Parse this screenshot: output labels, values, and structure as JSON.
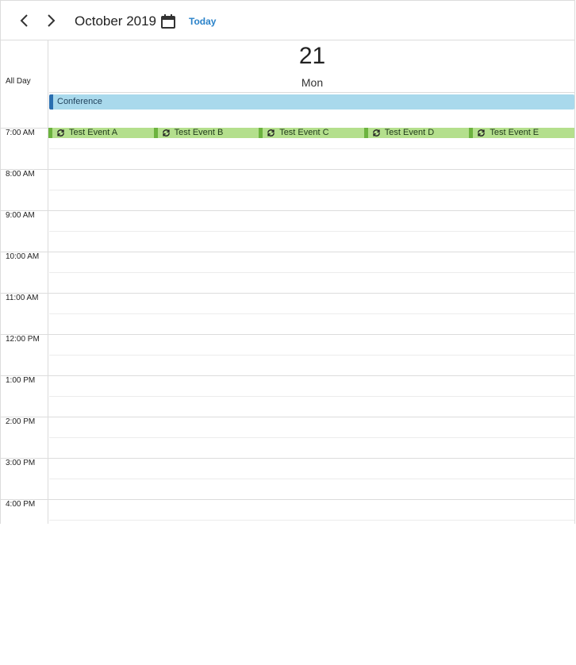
{
  "toolbar": {
    "title": "October 2019",
    "today_label": "Today",
    "prev_icon": "chevron-left-icon",
    "next_icon": "chevron-right-icon",
    "calendar_icon": "calendar-icon"
  },
  "day": {
    "number": "21",
    "name": "Mon"
  },
  "allday": {
    "label": "All Day",
    "event": {
      "title": "Conference",
      "color": "#a9d9ec",
      "accent": "#2a6fb0"
    }
  },
  "hours": [
    "7:00 AM",
    "8:00 AM",
    "9:00 AM",
    "10:00 AM",
    "11:00 AM",
    "12:00 PM",
    "1:00 PM",
    "2:00 PM",
    "3:00 PM",
    "4:00 PM"
  ],
  "events": [
    {
      "title": "Test Event A",
      "icon": "recurring-icon"
    },
    {
      "title": "Test Event B",
      "icon": "recurring-icon"
    },
    {
      "title": "Test Event C",
      "icon": "recurring-icon"
    },
    {
      "title": "Test Event D",
      "icon": "recurring-icon"
    },
    {
      "title": "Test Event E",
      "icon": "recurring-icon"
    }
  ],
  "colors": {
    "event_fill": "#b4df8d",
    "event_accent": "#6cb33f",
    "link": "#2a82c9"
  }
}
